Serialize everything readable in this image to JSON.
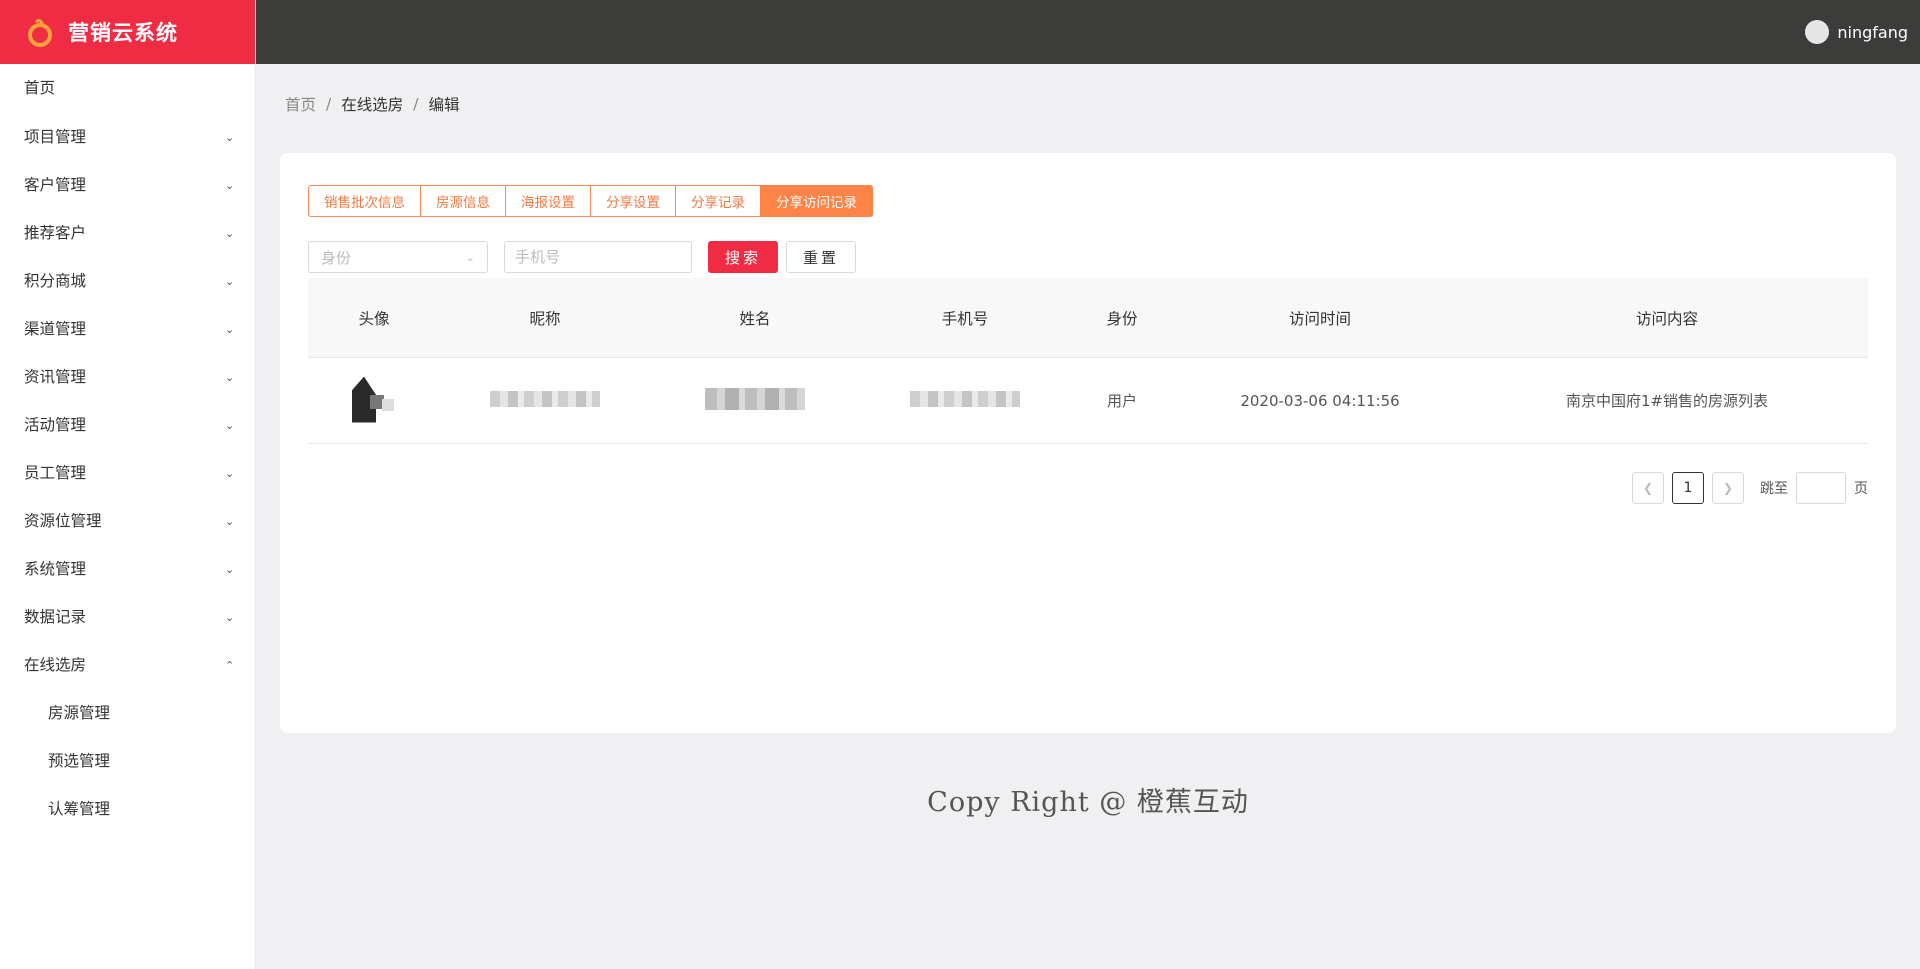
{
  "app": {
    "title": "营销云系统"
  },
  "user": {
    "name": "ningfang"
  },
  "sidebar": {
    "items": [
      {
        "label": "首页"
      },
      {
        "label": "项目管理"
      },
      {
        "label": "客户管理"
      },
      {
        "label": "推荐客户"
      },
      {
        "label": "积分商城"
      },
      {
        "label": "渠道管理"
      },
      {
        "label": "资讯管理"
      },
      {
        "label": "活动管理"
      },
      {
        "label": "员工管理"
      },
      {
        "label": "资源位管理"
      },
      {
        "label": "系统管理"
      },
      {
        "label": "数据记录"
      },
      {
        "label": "在线选房"
      }
    ],
    "subitems": [
      {
        "label": "房源管理"
      },
      {
        "label": "预选管理"
      },
      {
        "label": "认筹管理"
      }
    ]
  },
  "breadcrumb": {
    "home": "首页",
    "section": "在线选房",
    "current": "编辑",
    "sep": "/"
  },
  "tabs": [
    {
      "label": "销售批次信息"
    },
    {
      "label": "房源信息"
    },
    {
      "label": "海报设置"
    },
    {
      "label": "分享设置"
    },
    {
      "label": "分享记录"
    },
    {
      "label": "分享访问记录"
    }
  ],
  "filters": {
    "identity_placeholder": "身份",
    "phone_placeholder": "手机号",
    "search_label": "搜索",
    "reset_label": "重置"
  },
  "table": {
    "headers": [
      "头像",
      "昵称",
      "姓名",
      "手机号",
      "身份",
      "访问时间",
      "访问内容"
    ],
    "rows": [
      {
        "identity": "用户",
        "visit_time": "2020-03-06 04:11:56",
        "content": "南京中国府1#销售的房源列表"
      }
    ]
  },
  "pagination": {
    "current": "1",
    "jump_label": "跳至",
    "page_suffix": "页"
  },
  "footer": {
    "text": "Copy Right @ 橙蕉互动"
  },
  "colors": {
    "brand": "#f02c45",
    "accent": "#fd8346",
    "header": "#3c3d3a"
  }
}
